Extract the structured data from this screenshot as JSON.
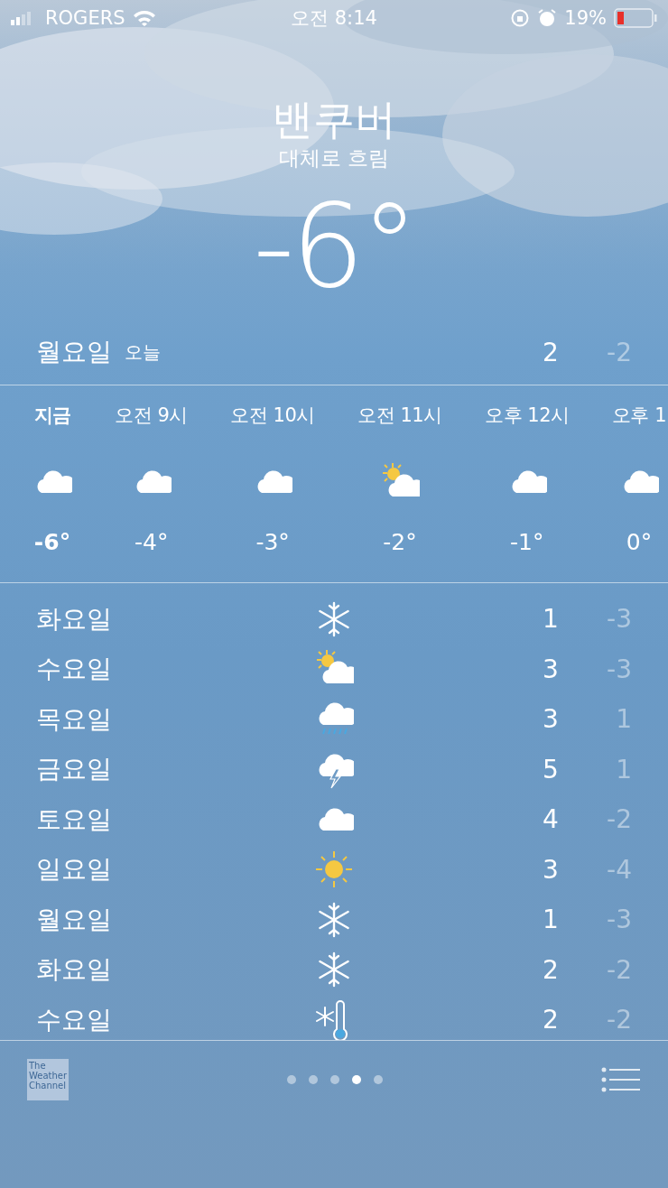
{
  "status_bar": {
    "carrier": "ROGERS",
    "time": "오전 8:14",
    "battery": "19%"
  },
  "location": {
    "city": "밴쿠버",
    "condition": "대체로 흐림",
    "temperature": "-6°"
  },
  "today": {
    "day": "월요일",
    "label": "오늘",
    "high": "2",
    "low": "-2"
  },
  "hourly": [
    {
      "time": "지금",
      "kind": "cloud",
      "temp": "-6°",
      "now": true
    },
    {
      "time": "오전 9시",
      "kind": "cloud",
      "temp": "-4°",
      "now": false
    },
    {
      "time": "오전 10시",
      "kind": "cloud",
      "temp": "-3°",
      "now": false
    },
    {
      "time": "오전 11시",
      "kind": "partly-sunny",
      "temp": "-2°",
      "now": false
    },
    {
      "time": "오후 12시",
      "kind": "cloud",
      "temp": "-1°",
      "now": false
    },
    {
      "time": "오후 1",
      "kind": "cloud",
      "temp": "0°",
      "now": false
    }
  ],
  "daily": [
    {
      "day": "화요일",
      "kind": "snow",
      "high": "1",
      "low": "-3"
    },
    {
      "day": "수요일",
      "kind": "partly-sunny",
      "high": "3",
      "low": "-3"
    },
    {
      "day": "목요일",
      "kind": "rain",
      "high": "3",
      "low": "1"
    },
    {
      "day": "금요일",
      "kind": "thunder",
      "high": "5",
      "low": "1"
    },
    {
      "day": "토요일",
      "kind": "cloud",
      "high": "4",
      "low": "-2"
    },
    {
      "day": "일요일",
      "kind": "sun",
      "high": "3",
      "low": "-4"
    },
    {
      "day": "월요일",
      "kind": "snow",
      "high": "1",
      "low": "-3"
    },
    {
      "day": "화요일",
      "kind": "snow",
      "high": "2",
      "low": "-2"
    },
    {
      "day": "수요일",
      "kind": "cold",
      "high": "2",
      "low": "-2"
    }
  ],
  "footer": {
    "logo": "The Weather Channel",
    "pages": [
      {
        "selected": false
      },
      {
        "selected": false
      },
      {
        "selected": false
      },
      {
        "selected": true
      },
      {
        "selected": false
      }
    ]
  }
}
